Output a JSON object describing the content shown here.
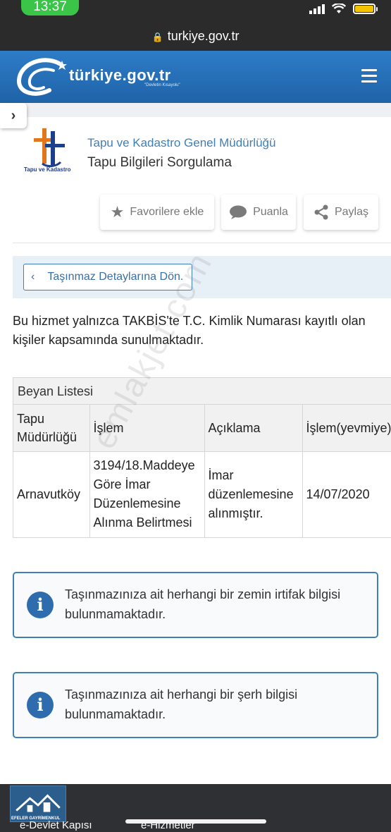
{
  "status_bar": {
    "time": "13:37"
  },
  "browser": {
    "url": "turkiye.gov.tr"
  },
  "header": {
    "logo_text": "türkiye.gov.tr",
    "logo_tagline": "\"Devletin Kısayolu\""
  },
  "organization": {
    "logo_label": "Tapu ve Kadastro",
    "name": "Tapu ve Kadastro Genel Müdürlüğü",
    "service_title": "Tapu Bilgileri Sorgulama"
  },
  "actions": [
    {
      "label": "Favorilere ekle",
      "icon": "star-icon"
    },
    {
      "label": "Puanla",
      "icon": "speech-bubble-icon"
    },
    {
      "label": "Paylaş",
      "icon": "share-icon"
    }
  ],
  "back_button": {
    "label": "Taşınmaz Detaylarına Dön."
  },
  "notice": "Bu hizmet yalnızca TAKBİS'te T.C. Kimlik Numarası kayıtlı olan kişiler kapsamında sunulmaktadır.",
  "declaration_table": {
    "caption": "Beyan Listesi",
    "columns": [
      "Tapu Müdürlüğü",
      "İşlem",
      "Açıklama",
      "İşlem(yevmiye) Tarihi"
    ],
    "rows": [
      [
        "Arnavutköy",
        "3194/18.Maddeye Göre İmar Düzenlemesine Alınma Belirtmesi",
        "İmar düzenlemesine alınmıştır.",
        "14/07/2020"
      ]
    ]
  },
  "info_messages": [
    "Taşınmazınıza ait herhangi bir zemin irtifak bilgisi bulunmamaktadır.",
    "Taşınmazınıza ait herhangi bir şerh bilgisi bulunmamaktadır."
  ],
  "watermark": "emlakjet.com",
  "footer": {
    "logo_label": "EFELER GAYRİMENKUL",
    "links": [
      "e-Devlet Kapısı",
      "e-Hizmetler"
    ]
  },
  "colors": {
    "header_blue": "#2b73bd",
    "accent_blue": "#3f7fb8",
    "status_green": "#3ac448"
  }
}
